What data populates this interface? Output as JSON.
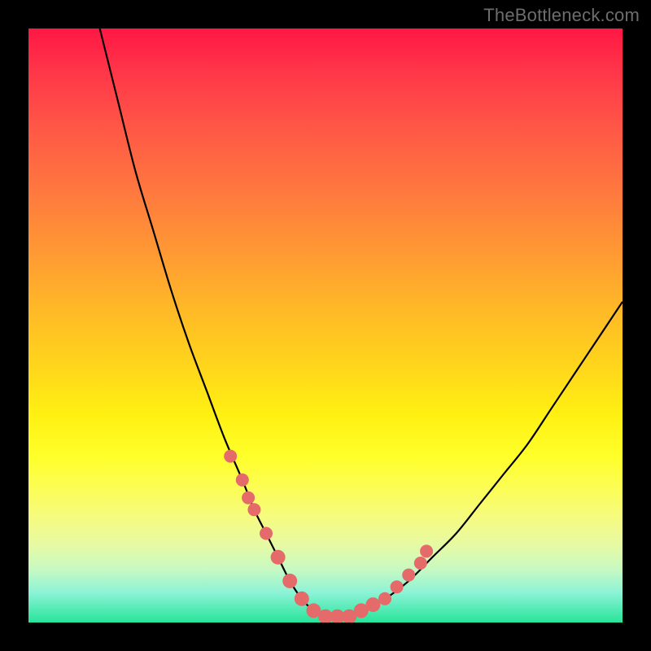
{
  "watermark": "TheBottleneck.com",
  "colors": {
    "background": "#000000",
    "curve": "#000000",
    "marker_fill": "#e46b6a",
    "marker_stroke": "#c75252",
    "gradient_top": "#ff1744",
    "gradient_bottom": "#27e49a"
  },
  "chart_data": {
    "type": "line",
    "title": "",
    "xlabel": "",
    "ylabel": "",
    "xlim": [
      0,
      100
    ],
    "ylim": [
      0,
      100
    ],
    "grid": false,
    "legend": false,
    "series": [
      {
        "name": "bottleneck-curve",
        "x": [
          12,
          15,
          18,
          21,
          24,
          27,
          30,
          33,
          36,
          38,
          40,
          42,
          44,
          46,
          48,
          50,
          52,
          54,
          56,
          60,
          64,
          68,
          72,
          76,
          80,
          84,
          88,
          92,
          96,
          100
        ],
        "values": [
          100,
          88,
          76,
          66,
          56,
          47,
          39,
          31,
          24,
          19,
          15,
          11,
          7,
          4,
          2,
          1,
          1,
          1,
          2,
          4,
          7,
          11,
          15,
          20,
          25,
          30,
          36,
          42,
          48,
          54
        ]
      }
    ],
    "markers": {
      "name": "highlight-points",
      "x": [
        34,
        36,
        37,
        38,
        40,
        42,
        44,
        46,
        48,
        50,
        52,
        54,
        56,
        58,
        60,
        62,
        64,
        66,
        67
      ],
      "values": [
        28,
        24,
        21,
        19,
        15,
        11,
        7,
        4,
        2,
        1,
        1,
        1,
        2,
        3,
        4,
        6,
        8,
        10,
        12
      ]
    }
  }
}
